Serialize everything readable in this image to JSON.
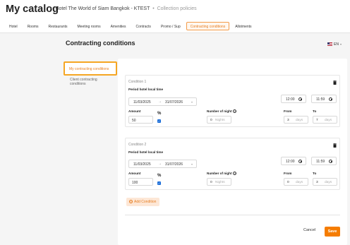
{
  "header": {
    "title": "My catalog",
    "hotel": "Hotel The World of Siam Bangkok - KTEST",
    "sep": "•",
    "section": "Collection policies"
  },
  "tabs": [
    "Hotel",
    "Rooms",
    "Restaurants",
    "Meeting rooms",
    "Amenities",
    "Contracts",
    "Promo / Sup",
    "Contracting conditions",
    "Allotments"
  ],
  "page": {
    "title": "Contracting conditions",
    "lang": "EN"
  },
  "sidebar": {
    "active": "My contracting conditions",
    "other": "Client contracting conditions"
  },
  "labels": {
    "period": "Period hotel local time",
    "amount": "Amount",
    "pct": "%",
    "nights": "Number of night",
    "from": "From",
    "to": "To",
    "nights_unit": "Nights",
    "days_unit": "days",
    "arrow": "→"
  },
  "conditions": [
    {
      "title": "Condition 1",
      "start": "11/03/2025",
      "end": "31/07/2026",
      "time_from": "12:00",
      "time_to": "11:59",
      "amount": "50",
      "nights": "0",
      "from": "3",
      "to": "7"
    },
    {
      "title": "Condition 2",
      "start": "11/03/2025",
      "end": "31/07/2026",
      "time_from": "12:00",
      "time_to": "11:59",
      "amount": "100",
      "nights": "0",
      "from": "0",
      "to": "3"
    }
  ],
  "actions": {
    "add": "Add Condition",
    "cancel": "Cancel",
    "save": "Save"
  },
  "colors": {
    "accent": "#f57c00",
    "highlight": "#f5a623"
  }
}
